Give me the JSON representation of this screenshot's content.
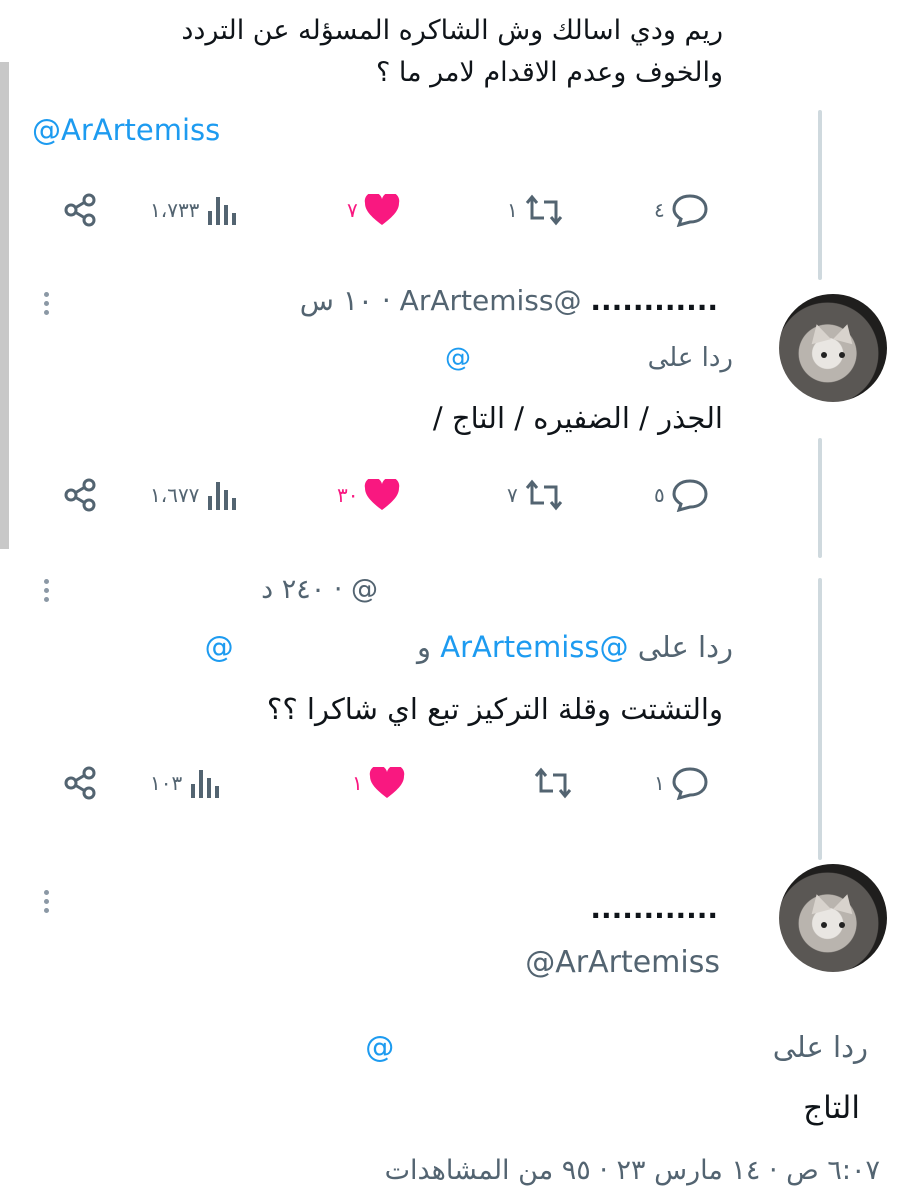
{
  "tweet1": {
    "text_line1": "ريم ودي اسالك وش الشاكره المسؤله عن التردد",
    "text_line2": "والخوف وعدم الاقدام لامر ما ؟",
    "mention": "@ArArtemiss",
    "actions": {
      "replies": "٤",
      "retweets": "١",
      "likes": "٧",
      "views": "١،٧٣٣"
    }
  },
  "tweet2": {
    "name": "............",
    "handle": "@ArArtemiss",
    "time": "· ١٠ س",
    "reply_prefix": "ردا على",
    "reply_mention": "@",
    "text": "الجذر / الضفيره / التاج /",
    "actions": {
      "replies": "٥",
      "retweets": "٧",
      "likes": "٣٠",
      "views": "١،٦٧٧"
    }
  },
  "tweet3": {
    "handle": "@",
    "time": "· ٢٤٠ د",
    "reply_prefix": "ردا على",
    "reply_mention1": "@ArArtemiss",
    "reply_and": "و",
    "reply_mention2": "@",
    "text": "والتشتت وقلة التركيز تبع اي شاكرا ؟؟",
    "actions": {
      "replies": "١",
      "retweets": "",
      "likes": "١",
      "views": "١٠٣"
    }
  },
  "tweet4": {
    "name": "............",
    "handle": "@ArArtemiss",
    "reply_prefix": "ردا على",
    "reply_mention": "@",
    "text": "التاج",
    "meta": "٦:٠٧ ص · ١٤ مارس ٢٣ · ٩٥ من المشاهدات",
    "meta_views": "٩٥"
  },
  "colors": {
    "link": "#1d9bf0",
    "like": "#f91880",
    "gray": "#536471",
    "thread_line": "#cfd9de"
  },
  "icons": [
    "reply-icon",
    "retweet-icon",
    "heart-icon",
    "views-icon",
    "share-icon",
    "more-icon"
  ]
}
